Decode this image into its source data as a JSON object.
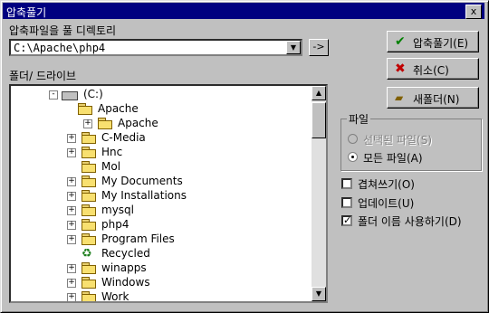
{
  "window": {
    "title": "압축풀기",
    "close_label": "x"
  },
  "dir_label": "압축파일을 풀 디렉토리",
  "path_value": "C:\\Apache\\php4",
  "go_label": "->",
  "folder_label": "폴더/ 드라이브",
  "tree": [
    {
      "label": "(C:)",
      "exp": "-"
    },
    {
      "label": "Apache",
      "exp": ""
    },
    {
      "label": "Apache",
      "exp": "+"
    },
    {
      "label": "C-Media",
      "exp": "+"
    },
    {
      "label": "Hnc",
      "exp": "+"
    },
    {
      "label": "Mol",
      "exp": ""
    },
    {
      "label": "My Documents",
      "exp": "+"
    },
    {
      "label": "My Installations",
      "exp": "+"
    },
    {
      "label": "mysql",
      "exp": "+"
    },
    {
      "label": "php4",
      "exp": "+"
    },
    {
      "label": "Program Files",
      "exp": "+"
    },
    {
      "label": "Recycled",
      "exp": ""
    },
    {
      "label": "winapps",
      "exp": "+"
    },
    {
      "label": "Windows",
      "exp": "+"
    },
    {
      "label": "Work",
      "exp": "+"
    }
  ],
  "buttons": {
    "extract": "압축풀기(E)",
    "cancel": "취소(C)",
    "new_folder": "새폴더(N)"
  },
  "file_group": {
    "title": "파일",
    "selected": "선택된 파일(S)",
    "all": "모든 파일(A)"
  },
  "options": {
    "overwrite": "겹쳐쓰기(O)",
    "update": "업데이트(U)",
    "use_folder_names": "폴더 이름 사용하기(D)"
  },
  "colors": {
    "titlebar": "#000080",
    "face": "#c0c0c0"
  }
}
